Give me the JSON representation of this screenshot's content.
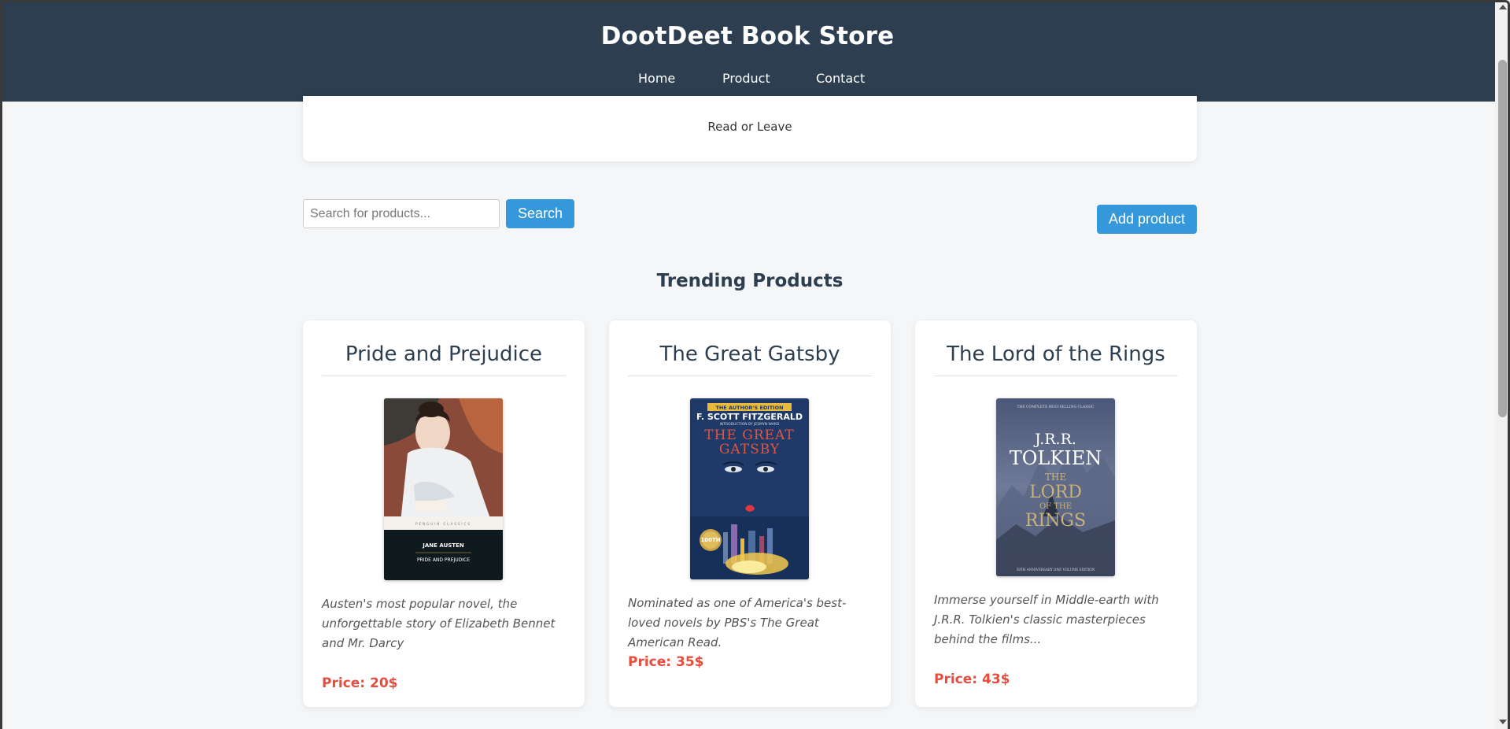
{
  "header": {
    "title": "DootDeet Book Store",
    "nav": [
      "Home",
      "Product",
      "Contact"
    ]
  },
  "tagline": "Read or Leave",
  "search": {
    "placeholder": "Search for products...",
    "value": "",
    "button_label": "Search"
  },
  "add_product_label": "Add product",
  "section_title": "Trending Products",
  "products": [
    {
      "title": "Pride and Prejudice",
      "cover_text": [
        "PENGUIN CLASSICS",
        "JANE AUSTEN",
        "PRIDE AND PREJUDICE"
      ],
      "description": "Austen's most popular novel, the unforgettable story of Elizabeth Bennet and Mr. Darcy",
      "price": "Price: 20$"
    },
    {
      "title": "The Great Gatsby",
      "cover_text": [
        "THE AUTHOR'S EDITION",
        "F. SCOTT FITZGERALD",
        "INTRODUCTION BY JESMYN WARD",
        "THE GREAT",
        "GATSBY",
        "100TH"
      ],
      "description": "Nominated as one of America's best-loved novels by PBS's The Great American Read.",
      "price": "Price: 35$"
    },
    {
      "title": "The Lord of the Rings",
      "cover_text": [
        "THE COMPLETE BEST-SELLING CLASSIC",
        "J.R.R.",
        "TOLKIEN",
        "THE",
        "LORD",
        "OF THE",
        "RINGS",
        "50TH ANNIVERSARY ONE VOLUME EDITION"
      ],
      "description": "Immerse yourself in Middle-earth with J.R.R. Tolkien's classic masterpieces behind the films...",
      "price": "Price: 43$"
    }
  ],
  "colors": {
    "header_bg": "#2c3e50",
    "accent": "#3498db",
    "price": "#e74c3c",
    "page_bg": "#f4f6f8"
  }
}
